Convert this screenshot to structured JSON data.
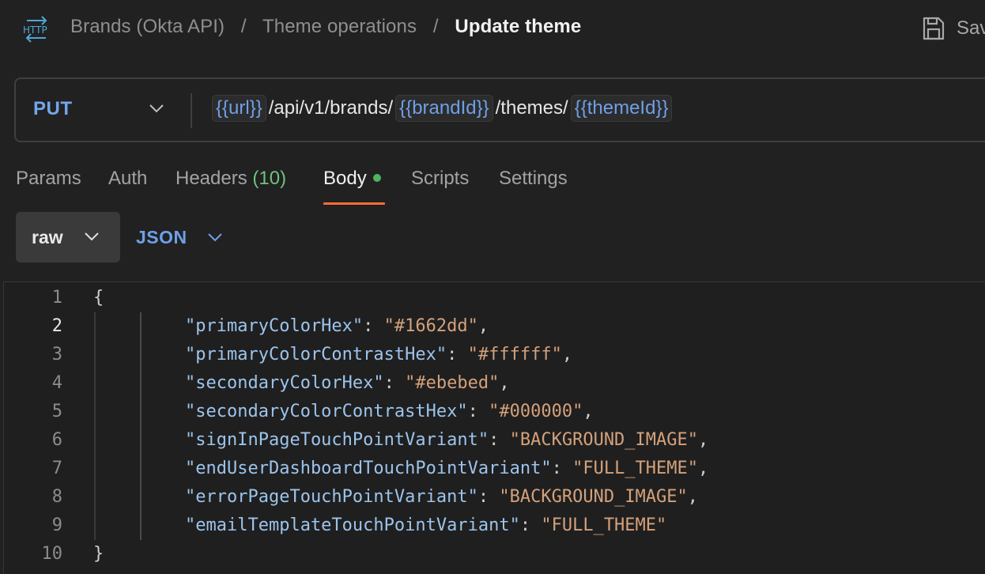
{
  "header": {
    "icon": "http-icon",
    "breadcrumb": [
      "Brands (Okta API)",
      "Theme operations"
    ],
    "separator": "/",
    "current": "Update theme",
    "save_label": "Sav"
  },
  "request": {
    "method": "PUT",
    "url_parts": [
      {
        "type": "var",
        "text": "{{url}}"
      },
      {
        "type": "text",
        "text": "/api/v1/brands/"
      },
      {
        "type": "var",
        "text": "{{brandId}}"
      },
      {
        "type": "text",
        "text": "/themes/"
      },
      {
        "type": "var",
        "text": "{{themeId}}"
      }
    ]
  },
  "tabs": {
    "params": "Params",
    "auth": "Auth",
    "headers": "Headers",
    "headers_count": "(10)",
    "body": "Body",
    "scripts": "Scripts",
    "settings": "Settings",
    "active": "Body"
  },
  "body_options": {
    "mode": "raw",
    "language": "JSON"
  },
  "editor": {
    "current_line": 2,
    "lines": [
      {
        "num": "1",
        "open": "{"
      },
      {
        "num": "2",
        "key": "\"primaryColorHex\"",
        "value": "\"#1662dd\"",
        "comma": true
      },
      {
        "num": "3",
        "key": "\"primaryColorContrastHex\"",
        "value": "\"#ffffff\"",
        "comma": true
      },
      {
        "num": "4",
        "key": "\"secondaryColorHex\"",
        "value": "\"#ebebed\"",
        "comma": true
      },
      {
        "num": "5",
        "key": "\"secondaryColorContrastHex\"",
        "value": "\"#000000\"",
        "comma": true
      },
      {
        "num": "6",
        "key": "\"signInPageTouchPointVariant\"",
        "value": "\"BACKGROUND_IMAGE\"",
        "comma": true
      },
      {
        "num": "7",
        "key": "\"endUserDashboardTouchPointVariant\"",
        "value": "\"FULL_THEME\"",
        "comma": true
      },
      {
        "num": "8",
        "key": "\"errorPageTouchPointVariant\"",
        "value": "\"BACKGROUND_IMAGE\"",
        "comma": true
      },
      {
        "num": "9",
        "key": "\"emailTemplateTouchPointVariant\"",
        "value": "\"FULL_THEME\"",
        "comma": false
      },
      {
        "num": "10",
        "close": "}"
      }
    ]
  },
  "colors": {
    "background": "#212121",
    "accent": "#ff6c37",
    "method": "#73a6ec",
    "variable": "#6f9fe8",
    "json_key": "#9cc4ec",
    "json_string": "#d4a17b",
    "status_dot": "#4fb35f"
  }
}
